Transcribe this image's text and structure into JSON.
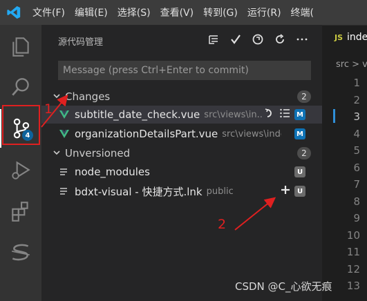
{
  "menubar": {
    "items": [
      "文件(F)",
      "编辑(E)",
      "选择(S)",
      "查看(V)",
      "转到(G)",
      "运行(R)",
      "终端("
    ]
  },
  "activity": {
    "scm_badge": "4"
  },
  "sidebar": {
    "title": "源代码管理",
    "commit_placeholder": "Message (press Ctrl+Enter to commit)",
    "changes": {
      "label": "Changes",
      "count": "2",
      "files": [
        {
          "name": "subtitle_date_check.vue",
          "path": "src\\views\\in...",
          "status": "M"
        },
        {
          "name": "organizationDetailsPart.vue",
          "path": "src\\views\\index...",
          "status": "M"
        }
      ]
    },
    "unversioned": {
      "label": "Unversioned",
      "count": "2",
      "files": [
        {
          "name": "node_modules",
          "path": "",
          "status": "U"
        },
        {
          "name": "bdxt-visual - 快捷方式.lnk",
          "path": "public",
          "status": "U"
        }
      ]
    }
  },
  "editor": {
    "tab_label": "inde",
    "breadcrumb": "src > v",
    "line_numbers": [
      "1",
      "2",
      "3",
      "4",
      "5",
      "6",
      "7",
      "8",
      "9",
      "10",
      "11",
      "12",
      "13"
    ]
  },
  "annotations": {
    "one": "1",
    "two": "2"
  },
  "watermark": "CSDN @C_心欲无痕",
  "colors": {
    "accent": "#0e639c",
    "annotation_red": "#e02020",
    "vue_green": "#41b883"
  }
}
